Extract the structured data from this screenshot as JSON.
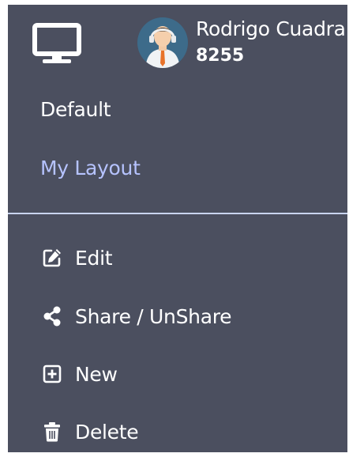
{
  "user": {
    "name": "Rodrigo Cuadra",
    "extension": "8255"
  },
  "layouts": {
    "items": [
      {
        "label": "Default",
        "active": false
      },
      {
        "label": "My Layout",
        "active": true
      }
    ]
  },
  "actions": {
    "edit_label": "Edit",
    "share_label": "Share / UnShare",
    "new_label": "New",
    "delete_label": "Delete"
  },
  "icons": {
    "monitor": "desktop-monitor-icon",
    "edit": "edit-icon",
    "share": "share-icon",
    "new": "plus-square-icon",
    "delete": "trash-icon"
  },
  "colors": {
    "panel_bg": "#4b4f5f",
    "active_layout": "#b6c3ff",
    "divider": "#c9d4ef",
    "text": "#ffffff"
  }
}
